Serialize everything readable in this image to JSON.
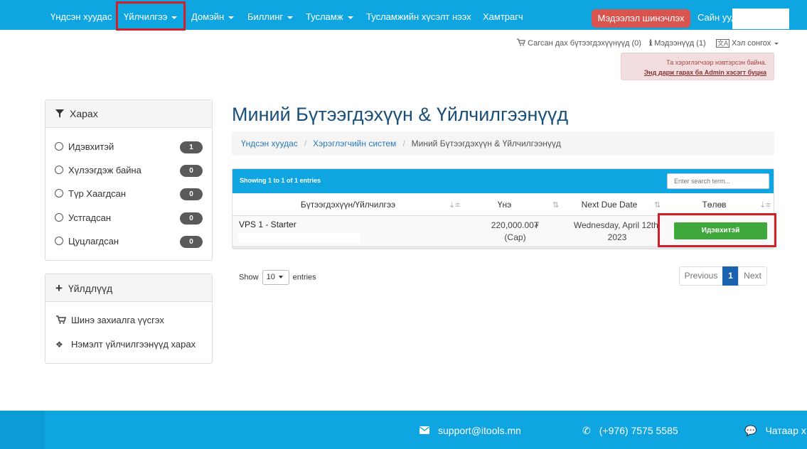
{
  "nav": {
    "items": [
      {
        "label": "Үндсэн хуудас",
        "caret": false
      },
      {
        "label": "Үйлчилгээ",
        "caret": true
      },
      {
        "label": "Домэйн",
        "caret": true
      },
      {
        "label": "Биллинг",
        "caret": true
      },
      {
        "label": "Тусламж",
        "caret": true
      },
      {
        "label": "Тусламжийн хүсэлт нээх",
        "caret": false
      },
      {
        "label": "Хамтрагч",
        "caret": false
      }
    ],
    "update_button": "Мэдээлэл шинэчлэх",
    "greeting": "Сайн уу,"
  },
  "utility": {
    "cart": "Сагсан дах бүтээгдэхүүнүүд (0)",
    "notifications": "Мэдээнүүд (1)",
    "language": "Хэл сонгох"
  },
  "alert": {
    "line1": "Та хэрэглэгчээр нэвтэрсэн байна.",
    "link": "Энд дарж гарах ба Admin хэсэгт буцна"
  },
  "sidebar": {
    "filter": {
      "title": "Харах",
      "items": [
        {
          "label": "Идэвхитэй",
          "count": "1"
        },
        {
          "label": "Хүлээгдэж байна",
          "count": "0"
        },
        {
          "label": "Түр Хаагдсан",
          "count": "0"
        },
        {
          "label": "Устгадсан",
          "count": "0"
        },
        {
          "label": "Цуцлагдсан",
          "count": "0"
        }
      ]
    },
    "actions": {
      "title": "Үйлдлүүд",
      "items": [
        {
          "label": "Шинэ захиалга үүсгэх",
          "icon": "cart-icon"
        },
        {
          "label": "Нэмэлт үйлчилгээнүүд харах",
          "icon": "cubes-icon"
        }
      ]
    }
  },
  "main": {
    "title": "Миний Бүтээгдэхүүн & Үйлчилгээнүүд",
    "breadcrumb": [
      "Үндсэн хуудас",
      "Хэрэглэгчийн систем",
      "Миний Бүтээгдэхүүн & Үйлчилгээнүүд"
    ],
    "table": {
      "info": "Showing 1 to 1 of 1 entries",
      "search_placeholder": "Enter search term...",
      "columns": [
        "Бүтээгдэхүүн/Үйлчилгээ",
        "Үнэ",
        "Next Due Date",
        "Төлөв"
      ],
      "rows": [
        {
          "product": "VPS 1 - Starter",
          "price": "220,000.00₮",
          "cycle": "(Сар)",
          "due_line1": "Wednesday, April 12th,",
          "due_line2": "2023",
          "status": "Идэвхитэй"
        }
      ]
    },
    "show_label": "Show",
    "show_value": "10",
    "entries_label": "entries",
    "pager": {
      "previous": "Previous",
      "current": "1",
      "next": "Next"
    }
  },
  "footer": {
    "email": "support@itools.mn",
    "phone": "(+976) 7575 5585",
    "chat": "Чатаар х"
  },
  "colors": {
    "brand": "#0ea5e0",
    "active_status": "#3fa83b",
    "highlight": "#d0202a"
  }
}
